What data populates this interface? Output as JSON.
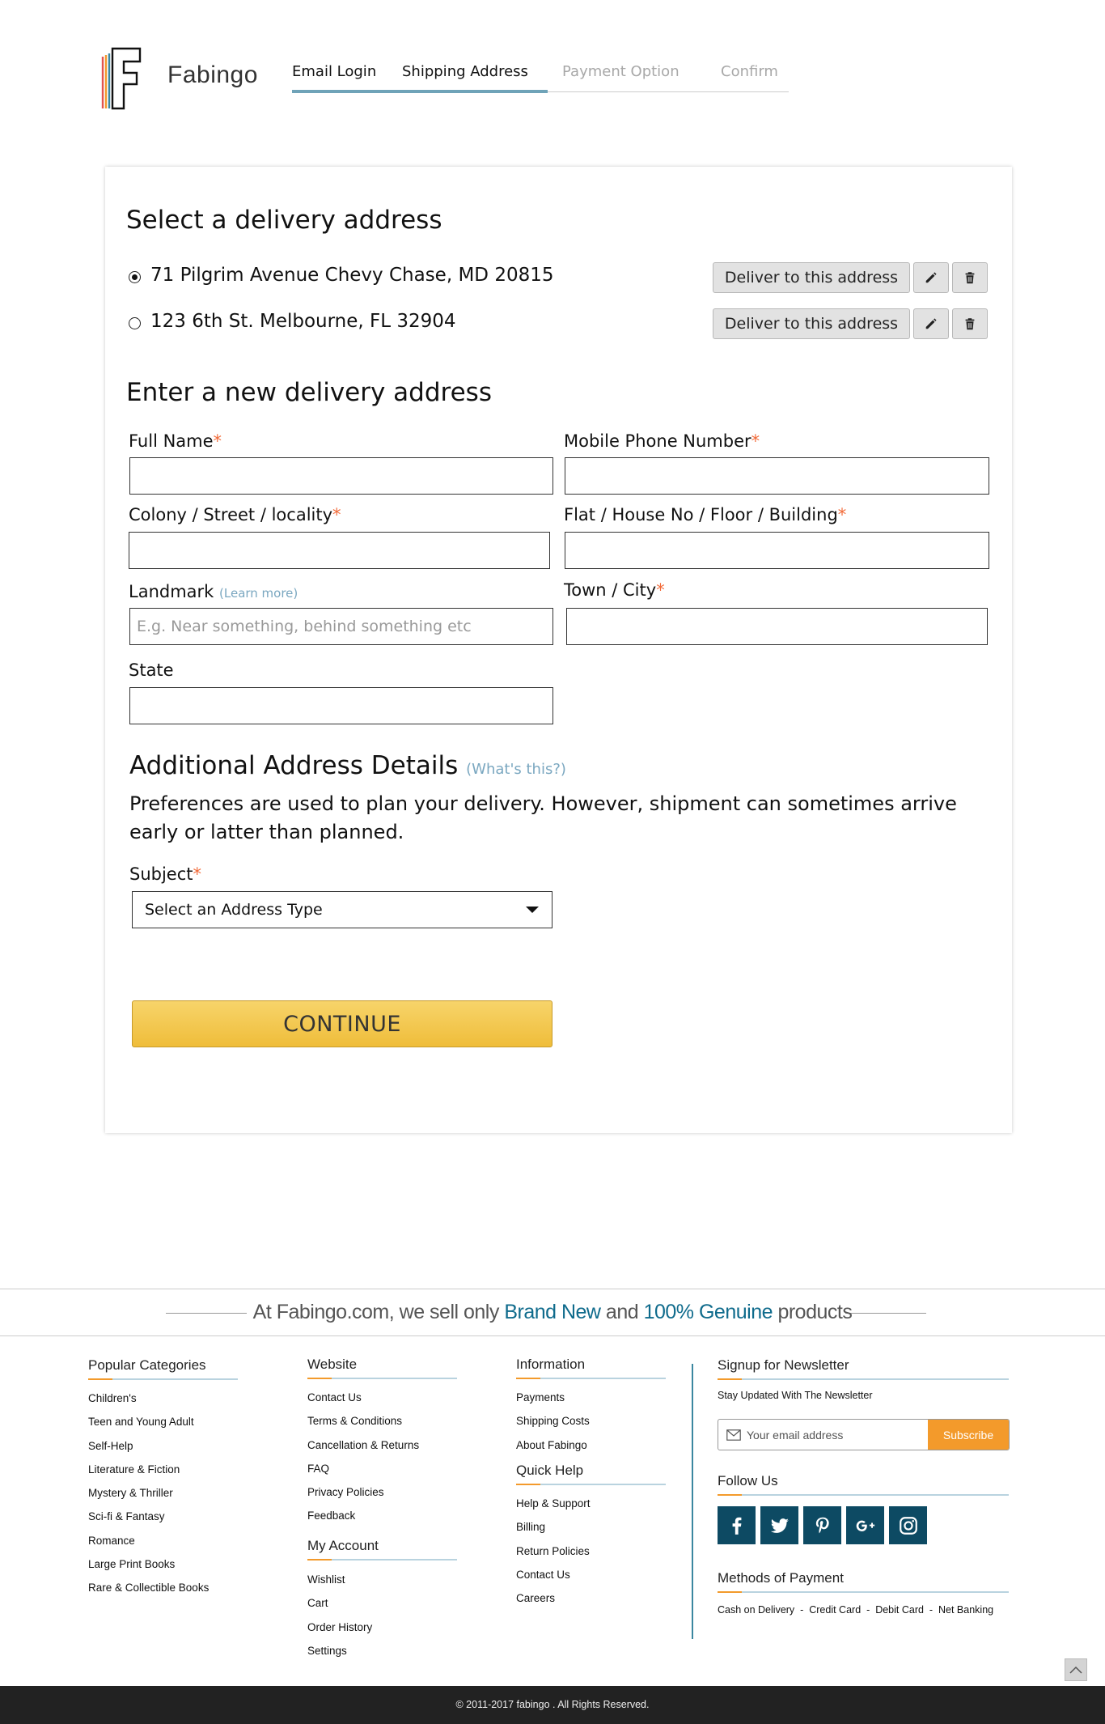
{
  "header": {
    "logo_letter": "F",
    "brand": "Fabingo",
    "steps": [
      {
        "label": "Email Login",
        "state": "done"
      },
      {
        "label": "Shipping Address",
        "state": "done"
      },
      {
        "label": "Payment Option",
        "state": "todo"
      },
      {
        "label": "Confirm",
        "state": "todo"
      }
    ]
  },
  "saved": {
    "title": "Select  a delivery address",
    "addresses": [
      {
        "text": "71 Pilgrim Avenue Chevy Chase, MD 20815",
        "selected": true
      },
      {
        "text": "123 6th St. Melbourne, FL 32904",
        "selected": false
      }
    ],
    "deliver_label": "Deliver to this address"
  },
  "form": {
    "title": "Enter a new delivery address",
    "full_name": "Full Name",
    "mobile": "Mobile Phone Number",
    "street": "Colony / Street / locality",
    "flat": "Flat / House No / Floor / Building",
    "landmark": "Landmark",
    "learn_more": "(Learn more)",
    "landmark_placeholder": "E.g. Near something, behind something etc",
    "town": "Town / City",
    "state": "State",
    "required_mark": "*"
  },
  "additional": {
    "title": "Additional Address Details",
    "whats_this": "(What's this?)",
    "description": "Preferences are used to plan your delivery. However, shipment can sometimes arrive early or latter than planned.",
    "subject_label": "Subject",
    "select_value": "Select an Address Type",
    "continue": "CONTINUE"
  },
  "footer": {
    "band": {
      "pre": "At Fabingo.com, we sell only ",
      "h1": "Brand New",
      "mid": " and ",
      "h2": "100% Genuine",
      "post": " products"
    },
    "popular": {
      "title": "Popular Categories",
      "items": [
        "Children's",
        "Teen and Young Adult",
        "Self-Help",
        "Literature & Fiction",
        "Mystery & Thriller",
        "Sci-fi & Fantasy",
        "Romance",
        "Large Print Books",
        "Rare & Collectible Books"
      ]
    },
    "website": {
      "title": "Website",
      "items": [
        "Contact Us",
        "Terms & Conditions",
        "Cancellation & Returns",
        "FAQ",
        "Privacy Policies",
        "Feedback"
      ]
    },
    "account": {
      "title": "My Account",
      "items": [
        "Wishlist",
        "Cart",
        "Order History",
        "Settings"
      ]
    },
    "information": {
      "title": "Information",
      "items": [
        "Payments",
        "Shipping Costs",
        "About Fabingo"
      ]
    },
    "quick_help": {
      "title": "Quick Help",
      "items": [
        "Help & Support",
        "Billing",
        "Return Policies",
        "Contact Us",
        "Careers"
      ]
    },
    "newsletter": {
      "title": "Signup for Newsletter",
      "subtitle": "Stay Updated With The Newsletter",
      "placeholder": "Your email address",
      "button": "Subscribe"
    },
    "follow": {
      "title": "Follow Us",
      "icons": [
        "facebook-icon",
        "twitter-icon",
        "pinterest-icon",
        "google-plus-icon",
        "instagram-icon"
      ]
    },
    "payment": {
      "title": "Methods of Payment",
      "methods": "Cash on Delivery  -  Credit Card  -  Debit Card  -  Net Banking"
    },
    "copyright": "© 2011-2017 fabingo . All Rights Reserved."
  },
  "colors": {
    "accent": "#0d4a63",
    "orange": "#f39a2b",
    "progress": "#6fa3b8",
    "continue": "#f2c54a"
  }
}
